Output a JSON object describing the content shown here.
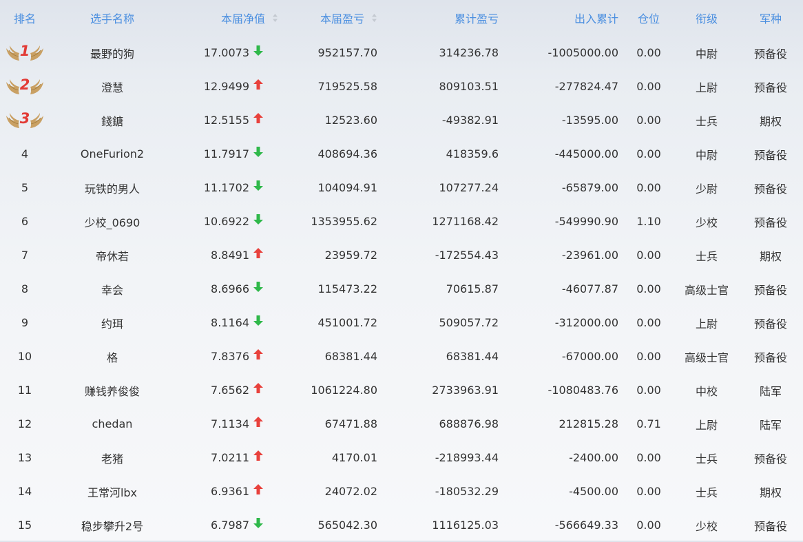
{
  "headers": {
    "rank": "排名",
    "name": "选手名称",
    "nav": "本届净值",
    "pnl": "本届盈亏",
    "cum_pnl": "累计盈亏",
    "flow": "出入累计",
    "position": "仓位",
    "title": "衔级",
    "branch": "军种"
  },
  "colors": {
    "header_text": "#4b8fe0",
    "up_arrow": "#e8413c",
    "down_arrow": "#2fb84a",
    "medal_number": "#e23b36",
    "medal_wing": "#c9a063"
  },
  "rows": [
    {
      "rank": "1",
      "name": "最野的狗",
      "nav": "17.0073",
      "trend": "down",
      "pnl": "952157.70",
      "cum": "314236.78",
      "flow": "-1005000.00",
      "pos": "0.00",
      "title": "中尉",
      "branch": "预备役"
    },
    {
      "rank": "2",
      "name": "澄慧",
      "nav": "12.9499",
      "trend": "up",
      "pnl": "719525.58",
      "cum": "809103.51",
      "flow": "-277824.47",
      "pos": "0.00",
      "title": "上尉",
      "branch": "预备役"
    },
    {
      "rank": "3",
      "name": "錢鎕",
      "nav": "12.5155",
      "trend": "up",
      "pnl": "12523.60",
      "cum": "-49382.91",
      "flow": "-13595.00",
      "pos": "0.00",
      "title": "士兵",
      "branch": "期权"
    },
    {
      "rank": "4",
      "name": "OneFurion2",
      "nav": "11.7917",
      "trend": "down",
      "pnl": "408694.36",
      "cum": "418359.6",
      "flow": "-445000.00",
      "pos": "0.00",
      "title": "中尉",
      "branch": "预备役"
    },
    {
      "rank": "5",
      "name": "玩铁的男人",
      "nav": "11.1702",
      "trend": "down",
      "pnl": "104094.91",
      "cum": "107277.24",
      "flow": "-65879.00",
      "pos": "0.00",
      "title": "少尉",
      "branch": "预备役"
    },
    {
      "rank": "6",
      "name": "少校_0690",
      "nav": "10.6922",
      "trend": "down",
      "pnl": "1353955.62",
      "cum": "1271168.42",
      "flow": "-549990.90",
      "pos": "1.10",
      "title": "少校",
      "branch": "预备役"
    },
    {
      "rank": "7",
      "name": "帝休若",
      "nav": "8.8491",
      "trend": "up",
      "pnl": "23959.72",
      "cum": "-172554.43",
      "flow": "-23961.00",
      "pos": "0.00",
      "title": "士兵",
      "branch": "期权"
    },
    {
      "rank": "8",
      "name": "幸会",
      "nav": "8.6966",
      "trend": "down",
      "pnl": "115473.22",
      "cum": "70615.87",
      "flow": "-46077.87",
      "pos": "0.00",
      "title": "高级士官",
      "branch": "预备役"
    },
    {
      "rank": "9",
      "name": "约珥",
      "nav": "8.1164",
      "trend": "down",
      "pnl": "451001.72",
      "cum": "509057.72",
      "flow": "-312000.00",
      "pos": "0.00",
      "title": "上尉",
      "branch": "预备役"
    },
    {
      "rank": "10",
      "name": "格",
      "nav": "7.8376",
      "trend": "up",
      "pnl": "68381.44",
      "cum": "68381.44",
      "flow": "-67000.00",
      "pos": "0.00",
      "title": "高级士官",
      "branch": "预备役"
    },
    {
      "rank": "11",
      "name": "赚钱养俊俊",
      "nav": "7.6562",
      "trend": "up",
      "pnl": "1061224.80",
      "cum": "2733963.91",
      "flow": "-1080483.76",
      "pos": "0.00",
      "title": "中校",
      "branch": "陆军"
    },
    {
      "rank": "12",
      "name": "chedan",
      "nav": "7.1134",
      "trend": "up",
      "pnl": "67471.88",
      "cum": "688876.98",
      "flow": "212815.28",
      "pos": "0.71",
      "title": "上尉",
      "branch": "陆军"
    },
    {
      "rank": "13",
      "name": "老猪",
      "nav": "7.0211",
      "trend": "up",
      "pnl": "4170.01",
      "cum": "-218993.44",
      "flow": "-2400.00",
      "pos": "0.00",
      "title": "士兵",
      "branch": "预备役"
    },
    {
      "rank": "14",
      "name": "王常河lbx",
      "nav": "6.9361",
      "trend": "up",
      "pnl": "24072.02",
      "cum": "-180532.29",
      "flow": "-4500.00",
      "pos": "0.00",
      "title": "士兵",
      "branch": "期权"
    },
    {
      "rank": "15",
      "name": "稳步攀升2号",
      "nav": "6.7987",
      "trend": "down",
      "pnl": "565042.30",
      "cum": "1116125.03",
      "flow": "-566649.33",
      "pos": "0.00",
      "title": "少校",
      "branch": "预备役"
    }
  ]
}
